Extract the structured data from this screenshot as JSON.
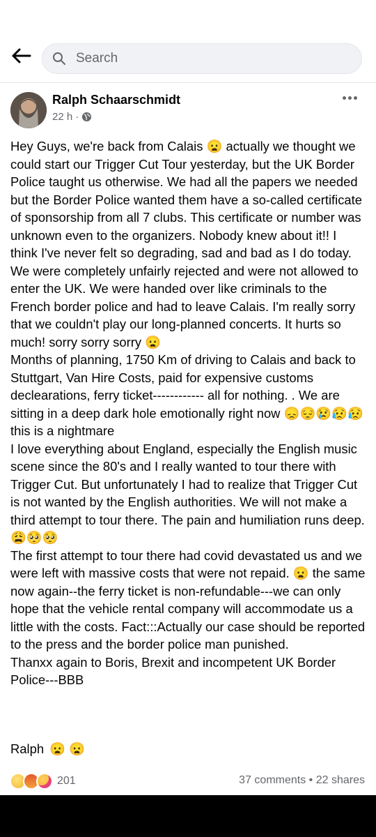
{
  "search": {
    "placeholder": "Search"
  },
  "post": {
    "author": "Ralph Schaarschmidt",
    "time": "22 h",
    "meta_sep": "·",
    "body": "Hey Guys, we're back from Calais 😦 actually we thought we could start our Trigger Cut Tour yesterday, but the UK Border Police taught us otherwise. We had all the papers we needed but the Border Police wanted them have a so-called certificate of sponsorship from all 7 clubs. This certificate or number was unknown even to the organizers. Nobody knew about it!! I think I've never felt so degrading, sad and bad as I do today. We were completely unfairly rejected and were not allowed to enter the UK. We were handed over like criminals to the French border police and had to leave Calais. I'm really sorry that we couldn't play our long-planned concerts. It hurts so much!  sorry sorry sorry  😦\nMonths of planning, 1750 Km of driving to Calais and back to Stuttgart, Van Hire Costs, paid for expensive customs declearations, ferry ticket------------ all for nothing. .  We are sitting in a deep dark hole emotionally right now 😞😔😢😥😥 this is a nightmare\nI love everything about England, especially the English music scene since the 80's and I really wanted to tour there with Trigger Cut. But unfortunately I had to realize that Trigger Cut is not wanted by the English authorities. We will not make a third attempt to tour there. The pain and humiliation runs deep.  😩🥺🥺\nThe first attempt to tour there had covid devastated us and we were left with massive costs that were not repaid. 😦  the same now again--the ferry ticket is non-refundable---we can only hope that the vehicle rental company will accommodate us a little with the costs. Fact:::Actually our case should be reported to the press and the border police man punished.\nThanxx again to Boris, Brexit and incompetent UK Border Police---BBB",
    "signature": "Ralph",
    "signature_emojis": "😦 😦"
  },
  "footer": {
    "reaction_count": "201",
    "comments": "37 comments",
    "separator": "•",
    "shares": "22 shares"
  },
  "colors": {
    "secondary_text": "#65676b",
    "search_bg": "#f0f2f5",
    "nav_bar": "#000000"
  },
  "icons": [
    "back-arrow-icon",
    "search-icon",
    "globe-icon",
    "more-options-icon",
    "sad-reaction-icon",
    "angry-reaction-icon",
    "care-reaction-icon"
  ]
}
